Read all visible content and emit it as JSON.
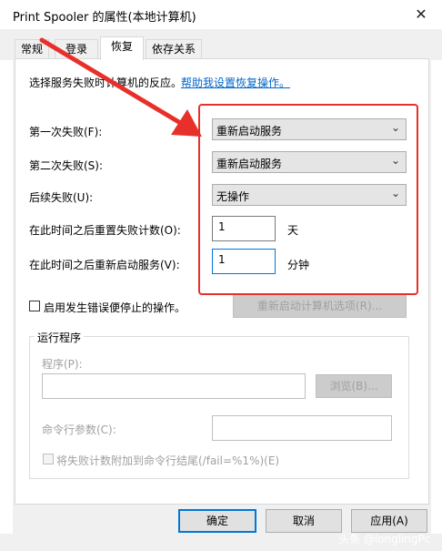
{
  "window": {
    "title": "Print Spooler 的属性(本地计算机)"
  },
  "tabs": [
    {
      "label": "常规"
    },
    {
      "label": "登录"
    },
    {
      "label": "恢复"
    },
    {
      "label": "依存关系"
    }
  ],
  "recovery": {
    "intro": "选择服务失败时计算机的反应。",
    "help_link": "帮助我设置恢复操作。",
    "first_failure_label": "第一次失败(F):",
    "first_failure_value": "重新启动服务",
    "second_failure_label": "第二次失败(S):",
    "second_failure_value": "重新启动服务",
    "subsequent_failure_label": "后续失败(U):",
    "subsequent_failure_value": "无操作",
    "reset_fail_count_label": "在此时间之后重置失败计数(O):",
    "reset_fail_count_value": "1",
    "reset_fail_count_unit": "天",
    "restart_service_label": "在此时间之后重新启动服务(V):",
    "restart_service_value": "1",
    "restart_service_unit": "分钟",
    "enable_actions_label": "启用发生错误便停止的操作。",
    "restart_computer_options": "重新启动计算机选项(R)..."
  },
  "run_program": {
    "group_title": "运行程序",
    "program_label": "程序(P):",
    "program_value": "",
    "browse_button": "浏览(B)...",
    "cmdline_label": "命令行参数(C):",
    "cmdline_value": "",
    "append_fail_label": "将失败计数附加到命令行结尾(/fail=%1%)(E)"
  },
  "footer": {
    "ok": "确定",
    "cancel": "取消",
    "apply": "应用(A)"
  },
  "watermark": "头条 @longlingPc",
  "colors": {
    "accent": "#0078d7",
    "annotation": "#e8302a",
    "link": "#0066cc"
  }
}
